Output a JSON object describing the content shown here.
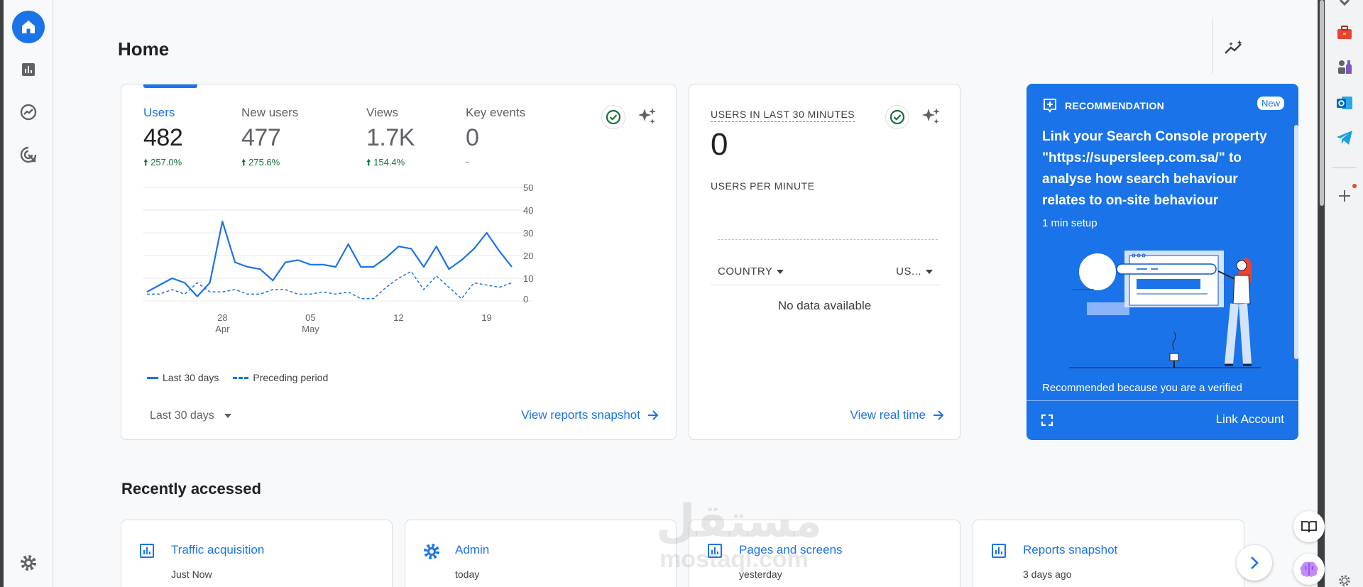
{
  "page": {
    "title": "Home"
  },
  "metrics": [
    {
      "label": "Users",
      "value": "482",
      "change": "257.0%",
      "selected": true
    },
    {
      "label": "New users",
      "value": "477",
      "change": "275.6%",
      "selected": false
    },
    {
      "label": "Views",
      "value": "1.7K",
      "change": "154.4%",
      "selected": false
    },
    {
      "label": "Key events",
      "value": "0",
      "change": "-",
      "selected": false
    }
  ],
  "chart_data": {
    "type": "line",
    "x_ticks": [
      {
        "label": "28",
        "sub": "Apr",
        "index": 6
      },
      {
        "label": "05",
        "sub": "May",
        "index": 13
      },
      {
        "label": "12",
        "sub": "",
        "index": 20
      },
      {
        "label": "19",
        "sub": "",
        "index": 27
      }
    ],
    "y_ticks": [
      0,
      10,
      20,
      30,
      40,
      50
    ],
    "ylim": [
      0,
      50
    ],
    "series": [
      {
        "name": "Last 30 days",
        "style": "solid",
        "values": [
          4,
          7,
          10,
          8,
          2,
          8,
          35,
          17,
          15,
          14,
          9,
          17,
          18,
          16,
          16,
          15,
          25,
          15,
          15,
          19,
          24,
          23,
          15,
          24,
          14,
          18,
          23,
          30,
          22,
          15
        ]
      },
      {
        "name": "Preceding period",
        "style": "dashed",
        "values": [
          3,
          3,
          5,
          3,
          8,
          4,
          4,
          5,
          3,
          3,
          5,
          5,
          3,
          3,
          4,
          3,
          4,
          1,
          1,
          6,
          10,
          13,
          5,
          11,
          6,
          1,
          8,
          7,
          6,
          8
        ]
      }
    ],
    "color": "#1a73e8"
  },
  "metrics_footer": {
    "date_range": "Last 30 days",
    "link": "View reports snapshot"
  },
  "realtime": {
    "heading": "USERS IN LAST 30 MINUTES",
    "value": "0",
    "sub": "USERS PER MINUTE",
    "col1": "COUNTRY",
    "col2": "US...",
    "no_data": "No data available",
    "link": "View real time"
  },
  "recommendation": {
    "label": "RECOMMENDATION",
    "badge": "New",
    "title": "Link your Search Console property \"https://supersleep.com.sa/\" to analyse how search behaviour relates to on-site behaviour",
    "setup": "1 min setup",
    "note": "Recommended because you are a verified",
    "link": "Link Account"
  },
  "recent": {
    "title": "Recently accessed",
    "items": [
      {
        "title": "Traffic acquisition",
        "time": "Just Now",
        "icon": "bar-chart-icon"
      },
      {
        "title": "Admin",
        "time": "today",
        "icon": "gear-icon"
      },
      {
        "title": "Pages and screens",
        "time": "yesterday",
        "icon": "bar-chart-icon"
      },
      {
        "title": "Reports snapshot",
        "time": "3 days ago",
        "icon": "bar-chart-icon"
      }
    ]
  },
  "watermark": {
    "arabic": "مستقل",
    "latin": "mostaql.com"
  },
  "colors": {
    "accent": "#1a73e8",
    "positive": "#137333",
    "rail_bg": "#f8f9fa"
  }
}
